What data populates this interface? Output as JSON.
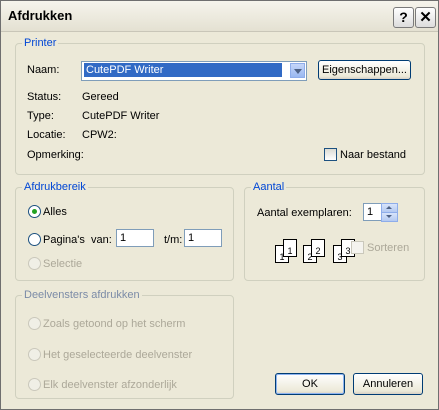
{
  "window": {
    "title": "Afdrukken",
    "help_glyph": "?",
    "close_glyph": "✕"
  },
  "printer": {
    "group_label": "Printer",
    "name_label": "Naam:",
    "name_value": "CutePDF Writer",
    "properties_button": "Eigenschappen...",
    "status_label": "Status:",
    "status_value": "Gereed",
    "type_label": "Type:",
    "type_value": "CutePDF Writer",
    "location_label": "Locatie:",
    "location_value": "CPW2:",
    "comment_label": "Opmerking:",
    "print_to_file_label": "Naar bestand"
  },
  "range": {
    "group_label": "Afdrukbereik",
    "all_label": "Alles",
    "pages_label": "Pagina's",
    "from_label": "van:",
    "from_value": "1",
    "to_label": "t/m:",
    "to_value": "1",
    "selection_label": "Selectie"
  },
  "copies": {
    "group_label": "Aantal",
    "count_label": "Aantal exemplaren:",
    "count_value": "1",
    "collate_label": "Sorteren",
    "page_glyphs": [
      "1",
      "1",
      "2",
      "2",
      "3",
      "3"
    ]
  },
  "frames": {
    "group_label": "Deelvensters afdrukken",
    "option1": "Zoals getoond op het scherm",
    "option2": "Het geselecteerde deelvenster",
    "option3": "Elk deelvenster afzonderlijk"
  },
  "buttons": {
    "ok": "OK",
    "cancel": "Annuleren"
  }
}
